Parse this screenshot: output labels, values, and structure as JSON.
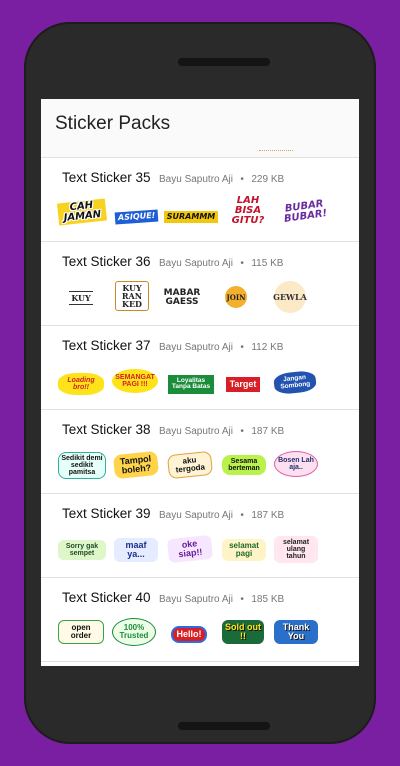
{
  "app": {
    "title": "Sticker Packs"
  },
  "packs": [
    {
      "name": "Text Sticker 35",
      "author": "Bayu Saputro Aji",
      "size": "229 KB",
      "stickers": [
        "CAH JAMAN",
        "ASIQUE!",
        "SURAMMM",
        "LAH BISA GITU?",
        "BUBAR BUBAR!"
      ]
    },
    {
      "name": "Text Sticker 36",
      "author": "Bayu Saputro Aji",
      "size": "115 KB",
      "stickers": [
        "KUY",
        "KUY RAN KED",
        "MABAR GAESS",
        "JOIN",
        "GEWLA"
      ]
    },
    {
      "name": "Text Sticker 37",
      "author": "Bayu Saputro Aji",
      "size": "112 KB",
      "stickers": [
        "Loading bro!!",
        "SEMANGAT PAGI !!!",
        "Loyalitas Tanpa Batas",
        "Target",
        "Jangan Sombong"
      ]
    },
    {
      "name": "Text Sticker 38",
      "author": "Bayu Saputro Aji",
      "size": "187 KB",
      "stickers": [
        "Sedikit demi sedikit pamitsa",
        "Tampol boleh?",
        "aku tergoda",
        "Sesama berteman",
        "Bosen Lah aja.."
      ]
    },
    {
      "name": "Text Sticker 39",
      "author": "Bayu Saputro Aji",
      "size": "187 KB",
      "stickers": [
        "Sorry gak sempet",
        "maaf ya...",
        "oke siap!!",
        "selamat pagi",
        "selamat ulang tahun"
      ]
    },
    {
      "name": "Text Sticker 40",
      "author": "Bayu Saputro Aji",
      "size": "185 KB",
      "stickers": [
        "open order",
        "100% Trusted",
        "Hello!",
        "Sold out !!",
        "Thank You"
      ]
    }
  ],
  "colors": {
    "background": "#7b1fa2",
    "phone": "#2a2a2a",
    "screen": "#ffffff",
    "divider": "#e2e2e2"
  },
  "icons": {
    "sticker-preview": "sticker-image-icon"
  }
}
